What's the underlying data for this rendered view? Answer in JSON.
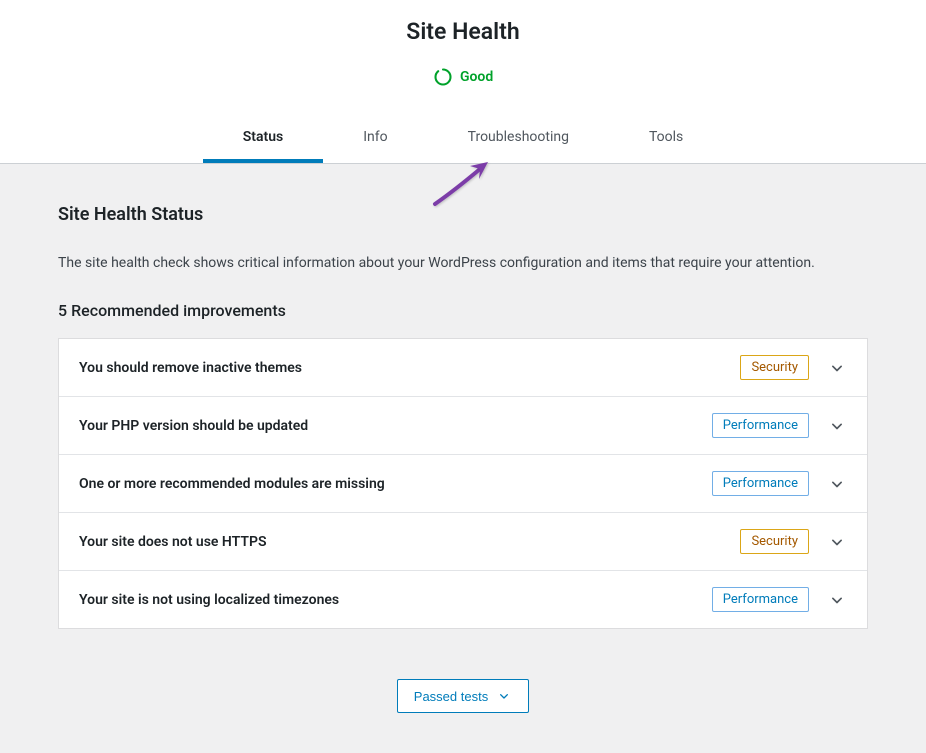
{
  "page_title": "Site Health",
  "status": {
    "label": "Good",
    "color": "#00a22a"
  },
  "tabs": [
    {
      "label": "Status",
      "active": true
    },
    {
      "label": "Info",
      "active": false
    },
    {
      "label": "Troubleshooting",
      "active": false
    },
    {
      "label": "Tools",
      "active": false
    }
  ],
  "section": {
    "heading": "Site Health Status",
    "description": "The site health check shows critical information about your WordPress configuration and items that require your attention.",
    "subheading": "5 Recommended improvements"
  },
  "improvements": [
    {
      "title": "You should remove inactive themes",
      "badge": "Security",
      "badge_type": "security"
    },
    {
      "title": "Your PHP version should be updated",
      "badge": "Performance",
      "badge_type": "performance"
    },
    {
      "title": "One or more recommended modules are missing",
      "badge": "Performance",
      "badge_type": "performance"
    },
    {
      "title": "Your site does not use HTTPS",
      "badge": "Security",
      "badge_type": "security"
    },
    {
      "title": "Your site is not using localized timezones",
      "badge": "Performance",
      "badge_type": "performance"
    }
  ],
  "passed_tests_label": "Passed tests"
}
